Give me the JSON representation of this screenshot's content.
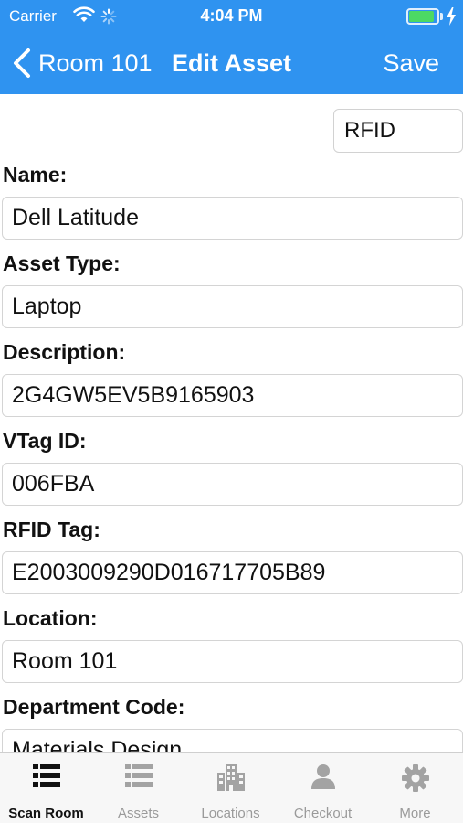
{
  "status_bar": {
    "carrier": "Carrier",
    "time": "4:04 PM",
    "battery_level": 0.9,
    "battery_color": "#4cd964"
  },
  "nav": {
    "back_label": "Room 101",
    "title": "Edit Asset",
    "save_label": "Save",
    "bar_color": "#2f93f0"
  },
  "rfid_button": {
    "label": "RFID"
  },
  "fields": [
    {
      "label": "Name:",
      "value": "Dell Latitude"
    },
    {
      "label": "Asset Type:",
      "value": "Laptop"
    },
    {
      "label": "Description:",
      "value": "2G4GW5EV5B9165903"
    },
    {
      "label": "VTag ID:",
      "value": "006FBA"
    },
    {
      "label": "RFID Tag:",
      "value": "E2003009290D016717705B89"
    },
    {
      "label": "Location:",
      "value": "Room 101"
    },
    {
      "label": "Department Code:",
      "value": "Materials Design"
    }
  ],
  "tabs": [
    {
      "label": "Scan Room",
      "icon": "list-icon",
      "active": true
    },
    {
      "label": "Assets",
      "icon": "list-icon",
      "active": false
    },
    {
      "label": "Locations",
      "icon": "building-icon",
      "active": false
    },
    {
      "label": "Checkout",
      "icon": "person-icon",
      "active": false
    },
    {
      "label": "More",
      "icon": "gear-icon",
      "active": false
    }
  ]
}
